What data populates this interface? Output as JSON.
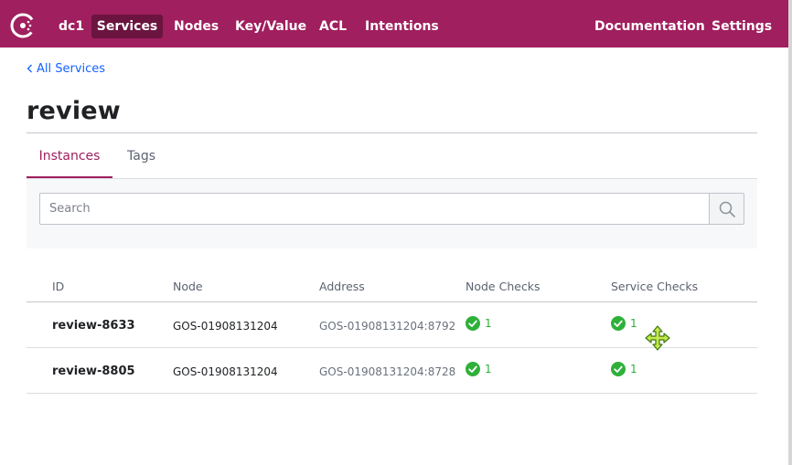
{
  "nav": {
    "datacenter": "dc1",
    "items": [
      {
        "label": "Services",
        "active": true
      },
      {
        "label": "Nodes",
        "active": false
      },
      {
        "label": "Key/Value",
        "active": false
      },
      {
        "label": "ACL",
        "active": false
      },
      {
        "label": "Intentions",
        "active": false
      }
    ],
    "right_items": [
      {
        "label": "Documentation"
      },
      {
        "label": "Settings"
      }
    ],
    "logo_icon": "consul-logo-icon"
  },
  "breadcrumb": {
    "label": "All Services",
    "icon": "chevron-left-icon"
  },
  "page": {
    "title": "review"
  },
  "tabs": [
    {
      "label": "Instances",
      "active": true
    },
    {
      "label": "Tags",
      "active": false
    }
  ],
  "search": {
    "placeholder": "Search",
    "value": "",
    "icon": "search-icon"
  },
  "table": {
    "columns": [
      "ID",
      "Node",
      "Address",
      "Node Checks",
      "Service Checks"
    ],
    "rows": [
      {
        "id": "review-8633",
        "node": "GOS-01908131204",
        "address": "GOS-01908131204:8792",
        "node_checks": "1",
        "service_checks": "1"
      },
      {
        "id": "review-8805",
        "node": "GOS-01908131204",
        "address": "GOS-01908131204:8728",
        "node_checks": "1",
        "service_checks": "1"
      }
    ]
  },
  "colors": {
    "brand": "#a01f5e",
    "brand_active": "#6b143f",
    "link": "#1563ff",
    "passing": "#2eb039"
  },
  "cursor": {
    "icon": "move-cursor-icon"
  }
}
